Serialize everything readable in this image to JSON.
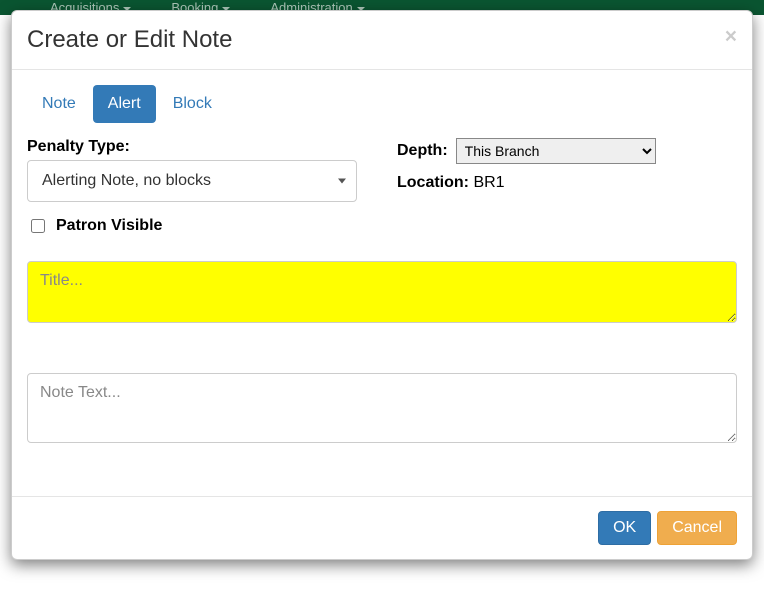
{
  "background_nav": {
    "items": [
      "Acquisitions",
      "Booking",
      "Administration"
    ]
  },
  "modal": {
    "title": "Create or Edit Note",
    "close_symbol": "×",
    "tabs": {
      "note": "Note",
      "alert": "Alert",
      "block": "Block",
      "active": "alert"
    },
    "penalty_type": {
      "label": "Penalty Type:",
      "selected": "Alerting Note, no blocks"
    },
    "depth": {
      "label": "Depth:",
      "selected": "This Branch"
    },
    "location": {
      "label": "Location:",
      "value": "BR1"
    },
    "patron_visible": {
      "label": "Patron Visible",
      "checked": false
    },
    "title_field": {
      "placeholder": "Title...",
      "value": ""
    },
    "note_field": {
      "placeholder": "Note Text...",
      "value": ""
    },
    "buttons": {
      "ok": "OK",
      "cancel": "Cancel"
    }
  }
}
